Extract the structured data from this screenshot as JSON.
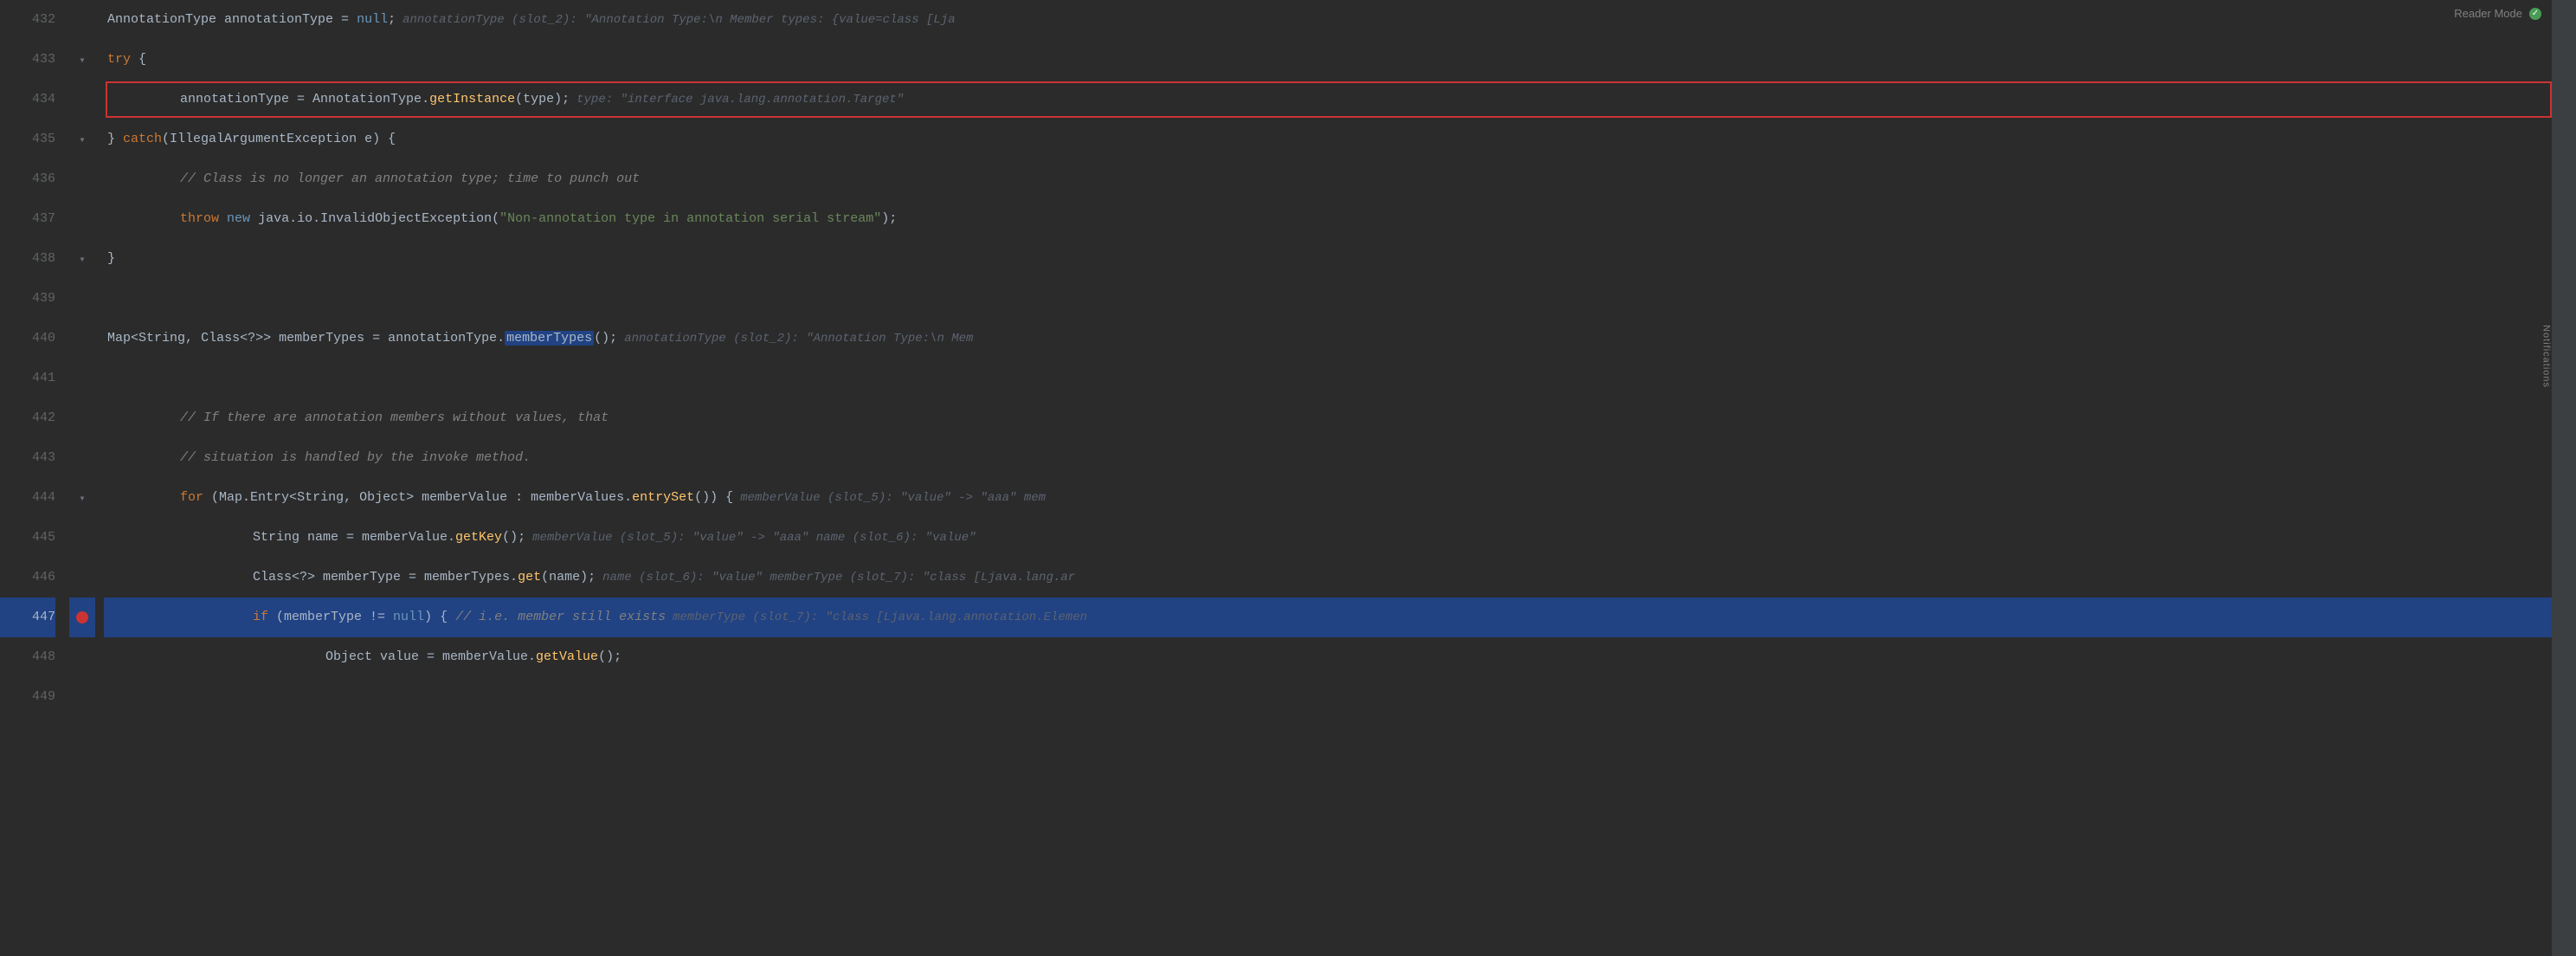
{
  "editor": {
    "background": "#2b2b2b",
    "reader_mode_label": "Reader Mode",
    "notifications_label": "Notifications",
    "lines": [
      {
        "num": "432",
        "gutter": "",
        "indent": 0,
        "tokens": [
          {
            "t": "type",
            "v": "AnnotationType"
          },
          {
            "t": "plain",
            "v": " annotationType = "
          },
          {
            "t": "kw-blue",
            "v": "null"
          },
          {
            "t": "plain",
            "v": ";"
          }
        ],
        "hint": "annotationType (slot_2): \"Annotation Type:\\n   Member types: {value=class [Lja",
        "highlight": false,
        "has_red_box": false
      },
      {
        "num": "433",
        "gutter": "fold",
        "indent": 0,
        "tokens": [
          {
            "t": "kw",
            "v": "try"
          },
          {
            "t": "plain",
            "v": " {"
          }
        ],
        "hint": "",
        "highlight": false,
        "has_red_box": false
      },
      {
        "num": "434",
        "gutter": "",
        "indent": 3,
        "tokens": [
          {
            "t": "plain",
            "v": "annotationType = "
          },
          {
            "t": "type",
            "v": "AnnotationType"
          },
          {
            "t": "plain",
            "v": "."
          },
          {
            "t": "method",
            "v": "getInstance"
          },
          {
            "t": "plain",
            "v": "(type);"
          }
        ],
        "hint": "type: \"interface java.lang.annotation.Target\"",
        "highlight": false,
        "has_red_box": true
      },
      {
        "num": "435",
        "gutter": "fold",
        "indent": 0,
        "tokens": [
          {
            "t": "plain",
            "v": "} "
          },
          {
            "t": "kw",
            "v": "catch"
          },
          {
            "t": "plain",
            "v": "("
          },
          {
            "t": "type",
            "v": "IllegalArgumentException"
          },
          {
            "t": "plain",
            "v": " e) {"
          }
        ],
        "hint": "",
        "highlight": false,
        "has_red_box": false
      },
      {
        "num": "436",
        "gutter": "",
        "indent": 3,
        "tokens": [
          {
            "t": "comment",
            "v": "// Class is no longer an annotation type; time to punch out"
          }
        ],
        "hint": "",
        "highlight": false,
        "has_red_box": false
      },
      {
        "num": "437",
        "gutter": "",
        "indent": 3,
        "tokens": [
          {
            "t": "kw",
            "v": "throw"
          },
          {
            "t": "plain",
            "v": " "
          },
          {
            "t": "kw-blue",
            "v": "new"
          },
          {
            "t": "plain",
            "v": " "
          },
          {
            "t": "type",
            "v": "java.io.InvalidObjectException"
          },
          {
            "t": "plain",
            "v": "("
          },
          {
            "t": "string",
            "v": "\"Non-annotation type in annotation serial stream\""
          },
          {
            "t": "plain",
            "v": ");"
          }
        ],
        "hint": "",
        "highlight": false,
        "has_red_box": false
      },
      {
        "num": "438",
        "gutter": "fold",
        "indent": 0,
        "tokens": [
          {
            "t": "plain",
            "v": "}"
          }
        ],
        "hint": "",
        "highlight": false,
        "has_red_box": false
      },
      {
        "num": "439",
        "gutter": "",
        "indent": 0,
        "tokens": [],
        "hint": "",
        "highlight": false,
        "has_red_box": false
      },
      {
        "num": "440",
        "gutter": "",
        "indent": 0,
        "tokens": [
          {
            "t": "type",
            "v": "Map"
          },
          {
            "t": "plain",
            "v": "<"
          },
          {
            "t": "type",
            "v": "String"
          },
          {
            "t": "plain",
            "v": ", "
          },
          {
            "t": "type",
            "v": "Class"
          },
          {
            "t": "plain",
            "v": "<?>> memberTypes = annotationType."
          },
          {
            "t": "selected-token",
            "v": "memberTypes"
          },
          {
            "t": "plain",
            "v": "();"
          }
        ],
        "hint": "annotationType (slot_2): \"Annotation Type:\\n  Mem",
        "highlight": false,
        "has_red_box": false
      },
      {
        "num": "441",
        "gutter": "",
        "indent": 0,
        "tokens": [],
        "hint": "",
        "highlight": false,
        "has_red_box": false
      },
      {
        "num": "442",
        "gutter": "",
        "indent": 3,
        "tokens": [
          {
            "t": "comment",
            "v": "// If there are annotation members without values, that"
          }
        ],
        "hint": "",
        "highlight": false,
        "has_red_box": false
      },
      {
        "num": "443",
        "gutter": "",
        "indent": 3,
        "tokens": [
          {
            "t": "comment",
            "v": "// situation is handled by the invoke method."
          }
        ],
        "hint": "",
        "highlight": false,
        "has_red_box": false
      },
      {
        "num": "444",
        "gutter": "fold",
        "indent": 3,
        "tokens": [
          {
            "t": "kw",
            "v": "for"
          },
          {
            "t": "plain",
            "v": " ("
          },
          {
            "t": "type",
            "v": "Map.Entry"
          },
          {
            "t": "plain",
            "v": "<"
          },
          {
            "t": "type",
            "v": "String"
          },
          {
            "t": "plain",
            "v": ", "
          },
          {
            "t": "type",
            "v": "Object"
          },
          {
            "t": "plain",
            "v": "> memberValue : memberValues."
          },
          {
            "t": "method",
            "v": "entrySet"
          },
          {
            "t": "plain",
            "v": "()) {"
          }
        ],
        "hint": "memberValue (slot_5): \"value\" -> \"aaa\"   mem",
        "highlight": false,
        "has_red_box": false
      },
      {
        "num": "445",
        "gutter": "",
        "indent": 6,
        "tokens": [
          {
            "t": "type",
            "v": "String"
          },
          {
            "t": "plain",
            "v": " name = memberValue."
          },
          {
            "t": "method",
            "v": "getKey"
          },
          {
            "t": "plain",
            "v": "();"
          }
        ],
        "hint": "memberValue (slot_5): \"value\" -> \"aaa\"   name (slot_6): \"value\"",
        "highlight": false,
        "has_red_box": false
      },
      {
        "num": "446",
        "gutter": "",
        "indent": 6,
        "tokens": [
          {
            "t": "type",
            "v": "Class"
          },
          {
            "t": "plain",
            "v": "<?> memberType = memberTypes."
          },
          {
            "t": "method",
            "v": "get"
          },
          {
            "t": "plain",
            "v": "(name);"
          }
        ],
        "hint": "name (slot_6): \"value\"   memberType (slot_7): \"class [Ljava.lang.ar",
        "highlight": false,
        "has_red_box": false
      },
      {
        "num": "447",
        "gutter": "breakpoint",
        "indent": 6,
        "tokens": [
          {
            "t": "kw",
            "v": "if"
          },
          {
            "t": "plain",
            "v": " (memberType != "
          },
          {
            "t": "kw-blue",
            "v": "null"
          },
          {
            "t": "plain",
            "v": ") {  "
          },
          {
            "t": "comment",
            "v": "// i.e. member still exists"
          }
        ],
        "hint": "memberType (slot_7): \"class [Ljava.lang.annotation.Elemen",
        "highlight": true,
        "has_red_box": false
      },
      {
        "num": "448",
        "gutter": "",
        "indent": 9,
        "tokens": [
          {
            "t": "type",
            "v": "Object"
          },
          {
            "t": "plain",
            "v": " value = memberValue."
          },
          {
            "t": "method",
            "v": "getValue"
          },
          {
            "t": "plain",
            "v": "();"
          }
        ],
        "hint": "",
        "highlight": false,
        "has_red_box": false
      },
      {
        "num": "449",
        "gutter": "",
        "indent": 0,
        "tokens": [],
        "hint": "",
        "highlight": false,
        "has_red_box": false
      }
    ]
  }
}
